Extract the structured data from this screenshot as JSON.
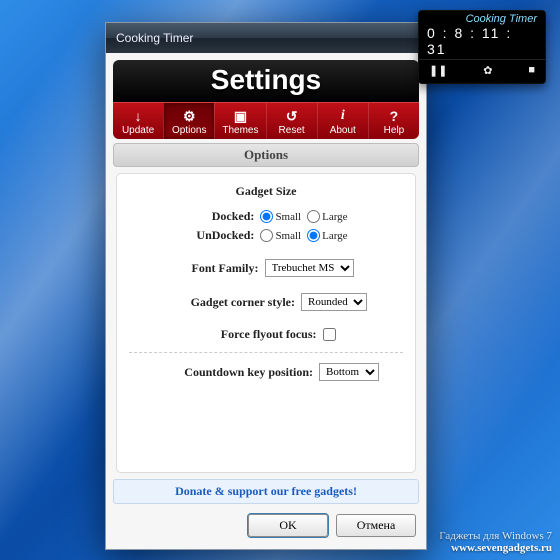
{
  "gadget": {
    "title": "Cooking Timer",
    "time": "0 : 8 : 11 : 31",
    "controls": {
      "pause": "❚❚",
      "settings": "✿",
      "stop": "■"
    }
  },
  "window": {
    "title": "Cooking Timer",
    "header": "Settings",
    "toolbar": [
      {
        "icon": "↓",
        "label": "Update"
      },
      {
        "icon": "⚙",
        "label": "Options",
        "selected": true
      },
      {
        "icon": "▣",
        "label": "Themes"
      },
      {
        "icon": "↺",
        "label": "Reset"
      },
      {
        "icon": "i",
        "label": "About"
      },
      {
        "icon": "?",
        "label": "Help"
      }
    ],
    "section": "Options",
    "options": {
      "size_heading": "Gadget Size",
      "docked_label": "Docked:",
      "undocked_label": "UnDocked:",
      "small": "Small",
      "large": "Large",
      "docked_value": "Small",
      "undocked_value": "Large",
      "font_label": "Font Family:",
      "font_value": "Trebuchet MS",
      "corner_label": "Gadget corner style:",
      "corner_value": "Rounded",
      "flyout_label": "Force flyout focus:",
      "flyout_checked": false,
      "countdown_label": "Countdown key position:",
      "countdown_value": "Bottom"
    },
    "donate": "Donate & support our free gadgets!",
    "buttons": {
      "ok": "OK",
      "cancel": "Отмена"
    }
  },
  "watermark": {
    "line1": "Гаджеты для Windows 7",
    "line2": "www.sevengadgets.ru"
  }
}
